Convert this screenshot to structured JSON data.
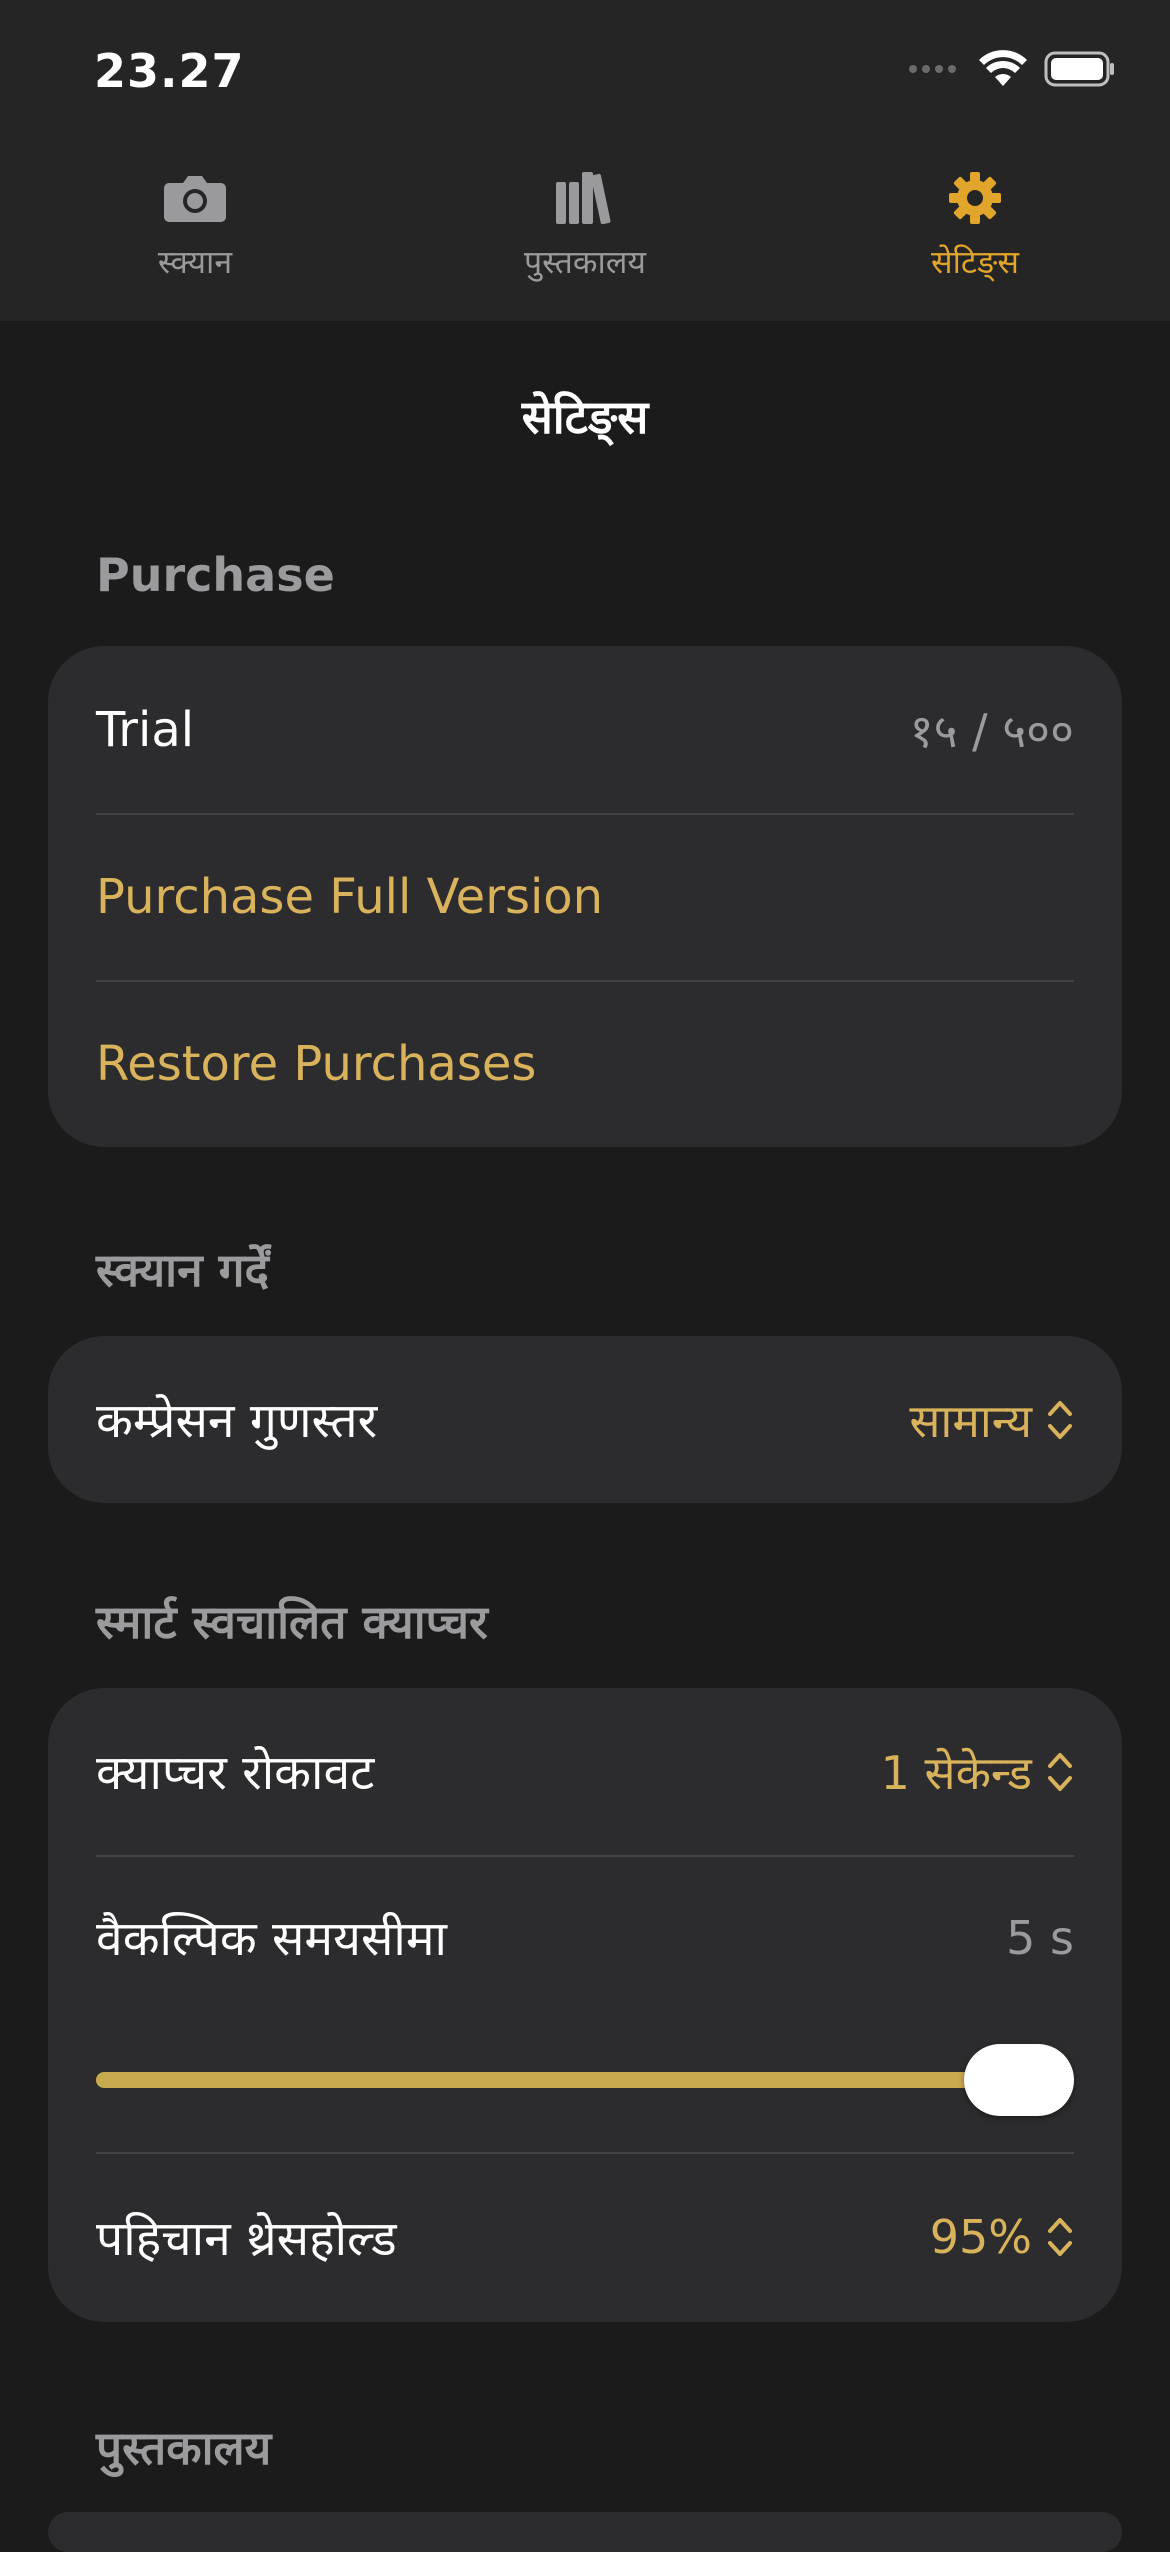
{
  "status_bar": {
    "time": "23.27"
  },
  "tabs": [
    {
      "label": "स्क्यान",
      "icon": "camera-icon",
      "active": false
    },
    {
      "label": "पुस्तकालय",
      "icon": "library-icon",
      "active": false
    },
    {
      "label": "सेटिङ्स",
      "icon": "gear-icon",
      "active": true
    }
  ],
  "nav": {
    "title": "सेटिङ्स"
  },
  "purchase": {
    "header": "Purchase",
    "trial_label": "Trial",
    "trial_value": "१५ / ५००",
    "purchase_full_label": "Purchase Full Version",
    "restore_label": "Restore Purchases"
  },
  "scan": {
    "header": "स्क्यान गर्दें",
    "compression_label": "कम्प्रेसन गुणस्तर",
    "compression_value": "सामान्य"
  },
  "smart_capture": {
    "header": "स्मार्ट स्वचालित क्याप्चर",
    "delay_label": "क्याप्चर रोकावट",
    "delay_value": "1 सेकेन्ड",
    "timeout_label": "वैकल्पिक समयसीमा",
    "timeout_value": "5 s",
    "timeout_slider_fraction": 1.0,
    "threshold_label": "पहिचान थ्रेसहोल्ड",
    "threshold_value": "95%"
  },
  "library": {
    "header": "पुस्तकालय"
  },
  "colors": {
    "accent": "#e2a52b",
    "accent_text": "#d9b35c",
    "background": "#1b1b1c",
    "card": "#2c2c2e"
  }
}
